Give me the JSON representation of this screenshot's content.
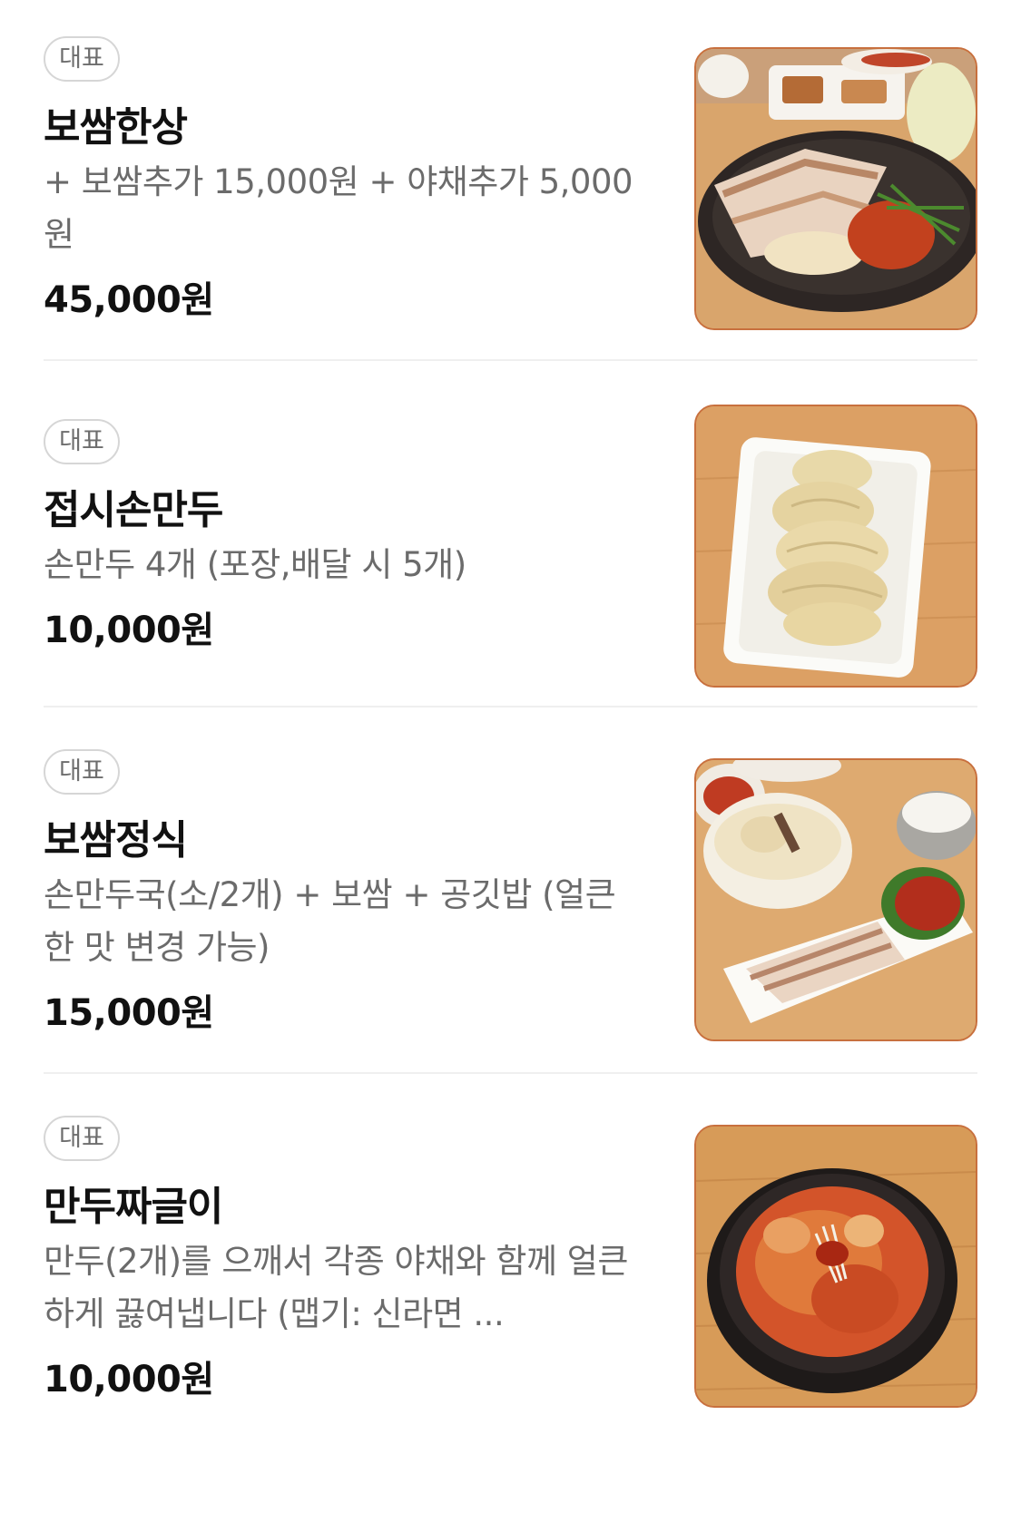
{
  "menu": {
    "items": [
      {
        "badge": "대표",
        "name": "보쌈한상",
        "description": "+ 보쌈추가 15,000원 + 야채추가 5,000원",
        "price": "45,000원",
        "image_icon": "bossam-platter-photo"
      },
      {
        "badge": "대표",
        "name": "접시손만두",
        "description": "손만두 4개 (포장,배달 시 5개)",
        "price": "10,000원",
        "image_icon": "dumpling-plate-photo"
      },
      {
        "badge": "대표",
        "name": "보쌈정식",
        "description": "손만두국(소/2개) + 보쌈 + 공깃밥 (얼큰한 맛 변경 가능)",
        "price": "15,000원",
        "image_icon": "bossam-set-meal-photo"
      },
      {
        "badge": "대표",
        "name": "만두짜글이",
        "description": "만두(2개)를 으깨서 각종 야채와 함께 얼큰하게 끓여냅니다 (맵기: 신라면 ...",
        "price": "10,000원",
        "image_icon": "dumpling-stew-photo"
      }
    ]
  },
  "colors": {
    "price_text": "#111111",
    "description_text": "#6b6b6b",
    "badge_border": "#d6d6d6",
    "divider": "#efefef",
    "photo_border": "#c8703e"
  }
}
